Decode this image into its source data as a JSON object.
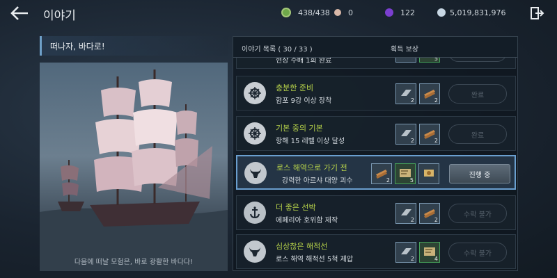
{
  "header": {
    "title": "이야기",
    "resources": [
      {
        "icon": "stamina-icon",
        "value": "438/438",
        "color": "#6fa84a"
      },
      {
        "icon": "pearl-icon",
        "value": "0",
        "color": "#d9b8a8"
      },
      {
        "icon": "purple-gem-icon",
        "value": "122",
        "color": "#7b3fd0"
      },
      {
        "icon": "silver-coin-icon",
        "value": "5,019,831,976",
        "color": "#c8d7e4"
      }
    ]
  },
  "story": {
    "subtitle": "떠나자, 바다로!",
    "caption": "다음에 떠날 모험은, 바로 광활한 바다다!"
  },
  "list": {
    "header_label": "이야기 목록 ( 30 / 33 )",
    "reward_label": "획득 보상",
    "partial_row_desc": "현상 수배 1회 완료",
    "items": [
      {
        "name": "충분한 준비",
        "desc": "함포 9강 이상 장착",
        "icon": "helm-icon",
        "rewards": [
          {
            "type": "steel",
            "count": "2",
            "color": "blue"
          },
          {
            "type": "plank",
            "count": "2",
            "color": "blue"
          }
        ],
        "status": "완료"
      },
      {
        "name": "기본 중의 기본",
        "desc": "항해 15 레벨 이상 달성",
        "icon": "helm-icon",
        "rewards": [
          {
            "type": "steel",
            "count": "2",
            "color": "blue"
          },
          {
            "type": "plank",
            "count": "2",
            "color": "blue"
          }
        ],
        "status": "완료"
      },
      {
        "name": "로스 해역으로 가기 전",
        "desc": "강력한 아르샤 대양 괴수",
        "icon": "bull-skull-icon",
        "rewards": [
          {
            "type": "plank",
            "count": "2",
            "color": "blue"
          },
          {
            "type": "map",
            "count": "5",
            "color": "green"
          },
          {
            "type": "scroll",
            "count": "",
            "color": "blue"
          }
        ],
        "status": "진행 중"
      },
      {
        "name": "더 좋은 선박",
        "desc": "에페리아 호위함 제작",
        "icon": "anchor-icon",
        "rewards": [
          {
            "type": "steel",
            "count": "2",
            "color": "blue"
          },
          {
            "type": "plank",
            "count": "2",
            "color": "blue"
          }
        ],
        "status": "수락 불가"
      },
      {
        "name": "심상찮은 해적선",
        "desc": "로스 해역 해적선 5척 제압",
        "icon": "bull-skull-icon",
        "rewards": [
          {
            "type": "steel",
            "count": "2",
            "color": "blue"
          },
          {
            "type": "map",
            "count": "4",
            "color": "green"
          }
        ],
        "status": "수락 불가"
      }
    ]
  }
}
